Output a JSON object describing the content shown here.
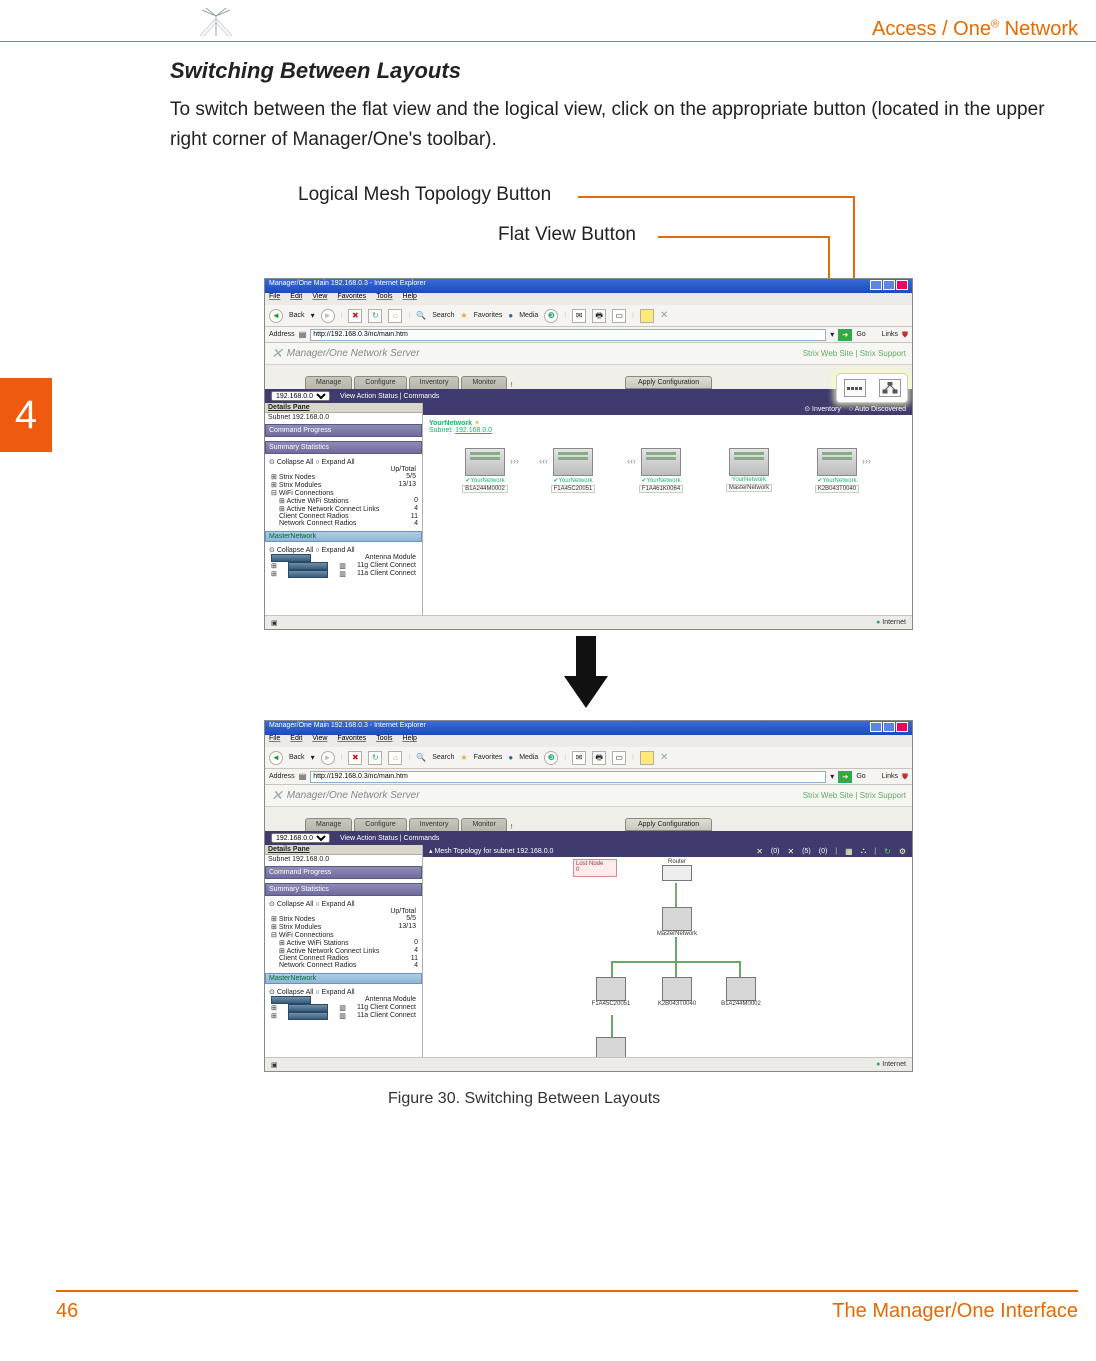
{
  "header": {
    "product": "Access / One",
    "registered": "®",
    "suffix": " Network"
  },
  "section_title": "Switching Between Layouts",
  "body_para": "To switch between the flat view and the logical view, click on the appropriate button (located in the upper right corner of Manager/One's toolbar).",
  "callout_logical": "Logical Mesh Topology Button",
  "callout_flat": "Flat View Button",
  "chapter_tab": "4",
  "figure_caption": "Figure 30. Switching Between Layouts",
  "page_number": "46",
  "footer_title": "The Manager/One Interface",
  "ie": {
    "title": "Manager/One Main 192.168.0.3 - Internet Explorer",
    "menus": [
      "File",
      "Edit",
      "View",
      "Favorites",
      "Tools",
      "Help"
    ],
    "back": "Back",
    "search": "Search",
    "favorites": "Favorites",
    "media": "Media",
    "address_label": "Address",
    "url": "http://192.168.0.3/nc/main.htm",
    "go": "Go",
    "links": "Links",
    "app_title": "Manager/One Network Server",
    "toplinks": "Strix Web Site  |  Strix Support",
    "tabs": [
      "Manage",
      "Configure",
      "Inventory",
      "Monitor"
    ],
    "apply": "Apply Configuration",
    "ip_select": "192.168.0.0",
    "action_bar": "View Action Status  |  Commands",
    "inv_radio": "Inventory",
    "auto_radio": "Auto Discovered",
    "details_pane": "Details Pane",
    "subnet_line": "Subnet 192.168.0.0",
    "command_progress": "Command Progress",
    "summary_stats": "Summary Statistics",
    "collapse_all": "Collapse All",
    "expand_all": "Expand All",
    "uptotal": "Up/Total",
    "rows": {
      "strix_nodes": "Strix Nodes",
      "strix_nodes_val": "5/5",
      "strix_modules": "Strix Modules",
      "strix_modules_val": "13/13",
      "wifi_conn": "WiFi Connections",
      "active_sta": "Active WiFi Stations",
      "active_sta_val": "0",
      "active_links": "Active Network Connect Links",
      "active_links_val": "4",
      "client_radios": "Client Connect Radios",
      "client_radios_val": "11",
      "net_radios": "Network Connect Radios",
      "net_radios_val": "4"
    },
    "master_network": "MasterNetwork",
    "antenna_module": "Antenna Module",
    "client11g": "11g Client Connect",
    "client11a": "11a Client Connect",
    "internet": "Internet",
    "your_network": "YourNetwork",
    "subnet_label": "Subnet:",
    "subnet_value": "192.168.0.0",
    "devices": [
      {
        "name": "YourNetwork",
        "id": "B1A244M0002"
      },
      {
        "name": "YourNetwork",
        "id": "F1A45C20051"
      },
      {
        "name": "YourNetwork",
        "id": "F1A461K0064"
      },
      {
        "name": "YourNetwork",
        "id": "MasterNetwork"
      },
      {
        "name": "YourNetwork",
        "id": "K2B043T0040"
      }
    ],
    "mesh_title": "Mesh Topology for subnet 192.168.0.0",
    "lost_node": "Lost Node",
    "lost_node_count": "0",
    "router": "Router",
    "mesh_counts": {
      "x": "(0)",
      "y": "(5)",
      "z": "(0)"
    }
  }
}
